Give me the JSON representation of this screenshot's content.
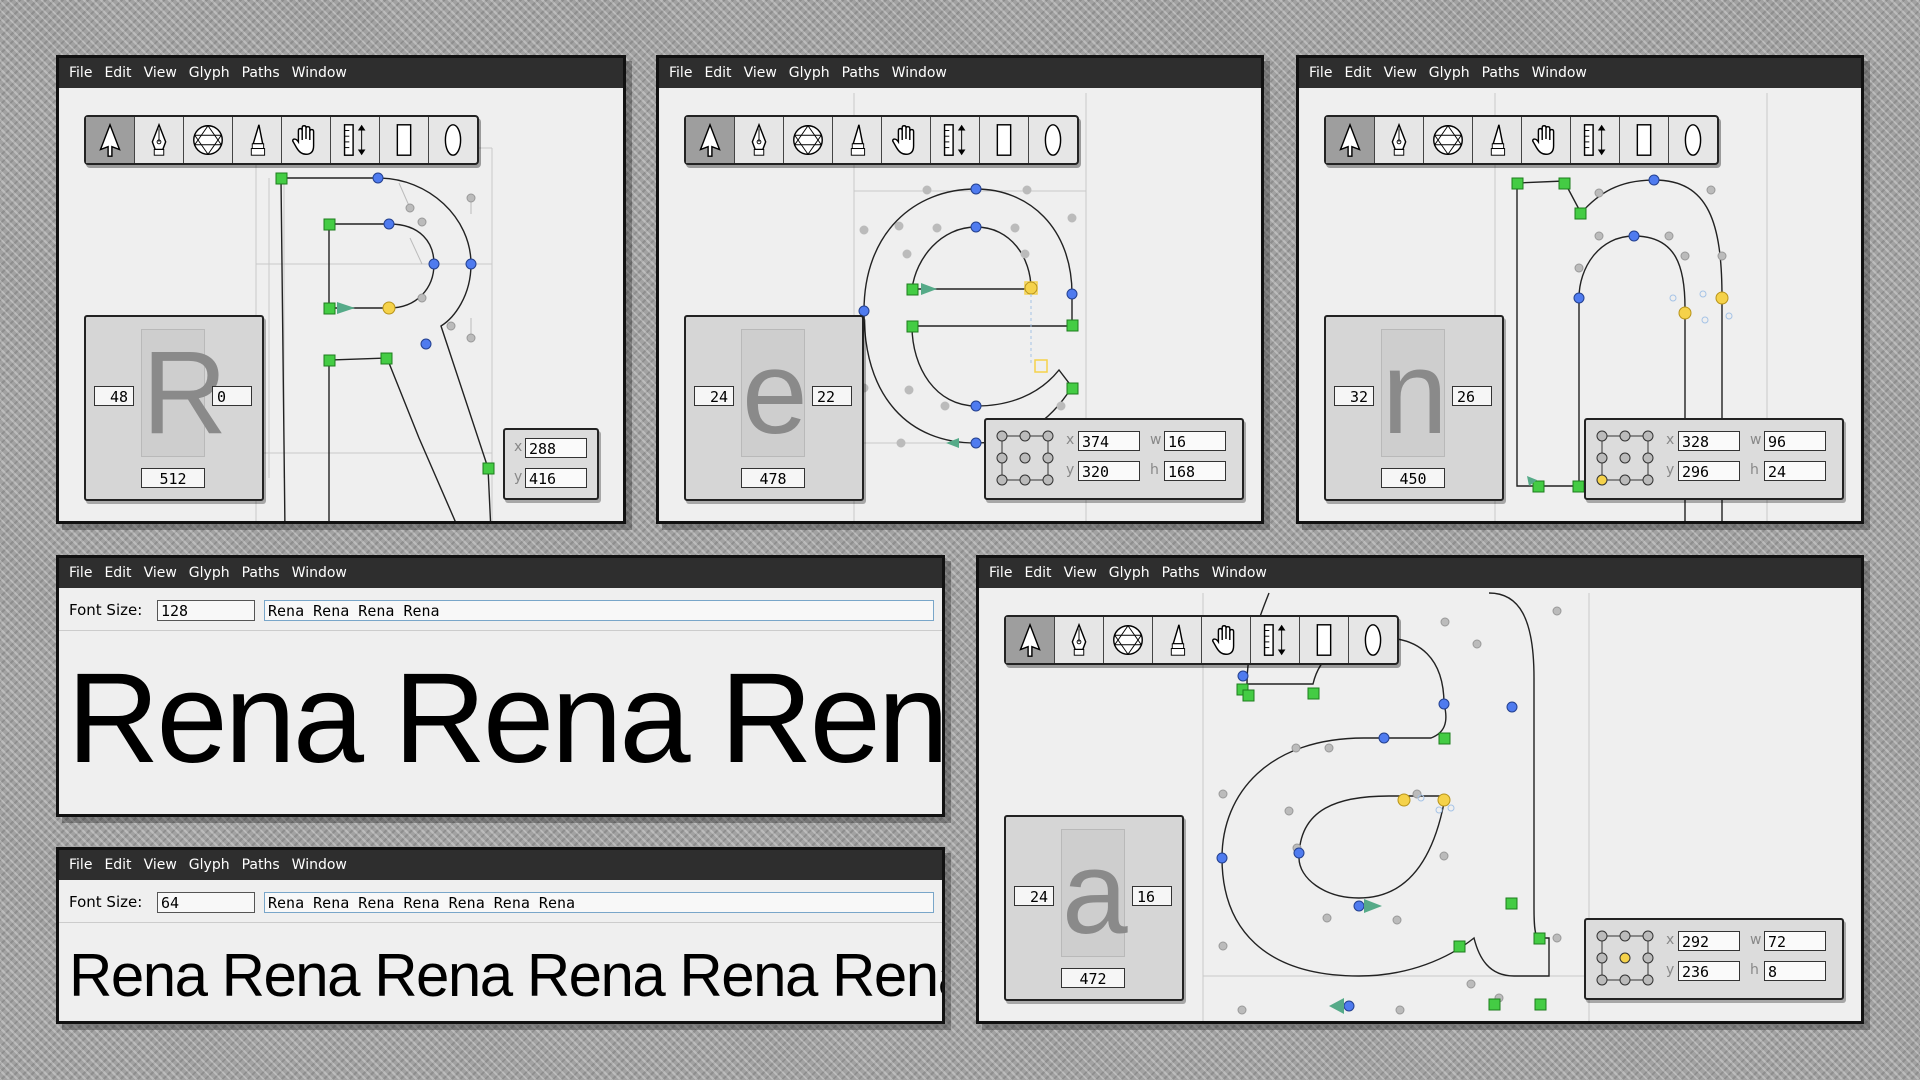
{
  "menu": [
    "File",
    "Edit",
    "View",
    "Glyph",
    "Paths",
    "Window"
  ],
  "tools": [
    "pointer-tool-icon",
    "pen-tool-icon",
    "knife-tool-icon",
    "brush-tool-icon",
    "hand-tool-icon",
    "measure-tool-icon",
    "rectangle-tool-icon",
    "ellipse-tool-icon"
  ],
  "editor_R": {
    "glyph": "R",
    "left_bearing": "48",
    "right_bearing": "0",
    "advance": "512",
    "x_label": "x",
    "y_label": "y",
    "x": "288",
    "y": "416"
  },
  "editor_e": {
    "glyph": "e",
    "left_bearing": "24",
    "right_bearing": "22",
    "advance": "478",
    "x_label": "x",
    "y_label": "y",
    "w_label": "w",
    "h_label": "h",
    "x": "374",
    "y": "320",
    "w": "16",
    "h": "168"
  },
  "editor_n": {
    "glyph": "n",
    "left_bearing": "32",
    "right_bearing": "26",
    "advance": "450",
    "x_label": "x",
    "y_label": "y",
    "w_label": "w",
    "h_label": "h",
    "x": "328",
    "y": "296",
    "w": "96",
    "h": "24"
  },
  "editor_a": {
    "glyph": "a",
    "left_bearing": "24",
    "right_bearing": "16",
    "advance": "472",
    "x_label": "x",
    "y_label": "y",
    "w_label": "w",
    "h_label": "h",
    "x": "292",
    "y": "236",
    "w": "72",
    "h": "8"
  },
  "preview_large": {
    "font_size_label": "Font Size:",
    "font_size": "128",
    "text": "Rena Rena Rena Rena"
  },
  "preview_small": {
    "font_size_label": "Font Size:",
    "font_size": "64",
    "text": "Rena Rena Rena Rena Rena Rena Rena"
  },
  "colors": {
    "on_curve_point": "#4f7bef",
    "corner_point": "#44cc44",
    "selected_point": "#f5d24a",
    "handle_point": "#bbbbbb",
    "start_arrow": "#55aa88",
    "title_bar": "#2e2e2e"
  }
}
